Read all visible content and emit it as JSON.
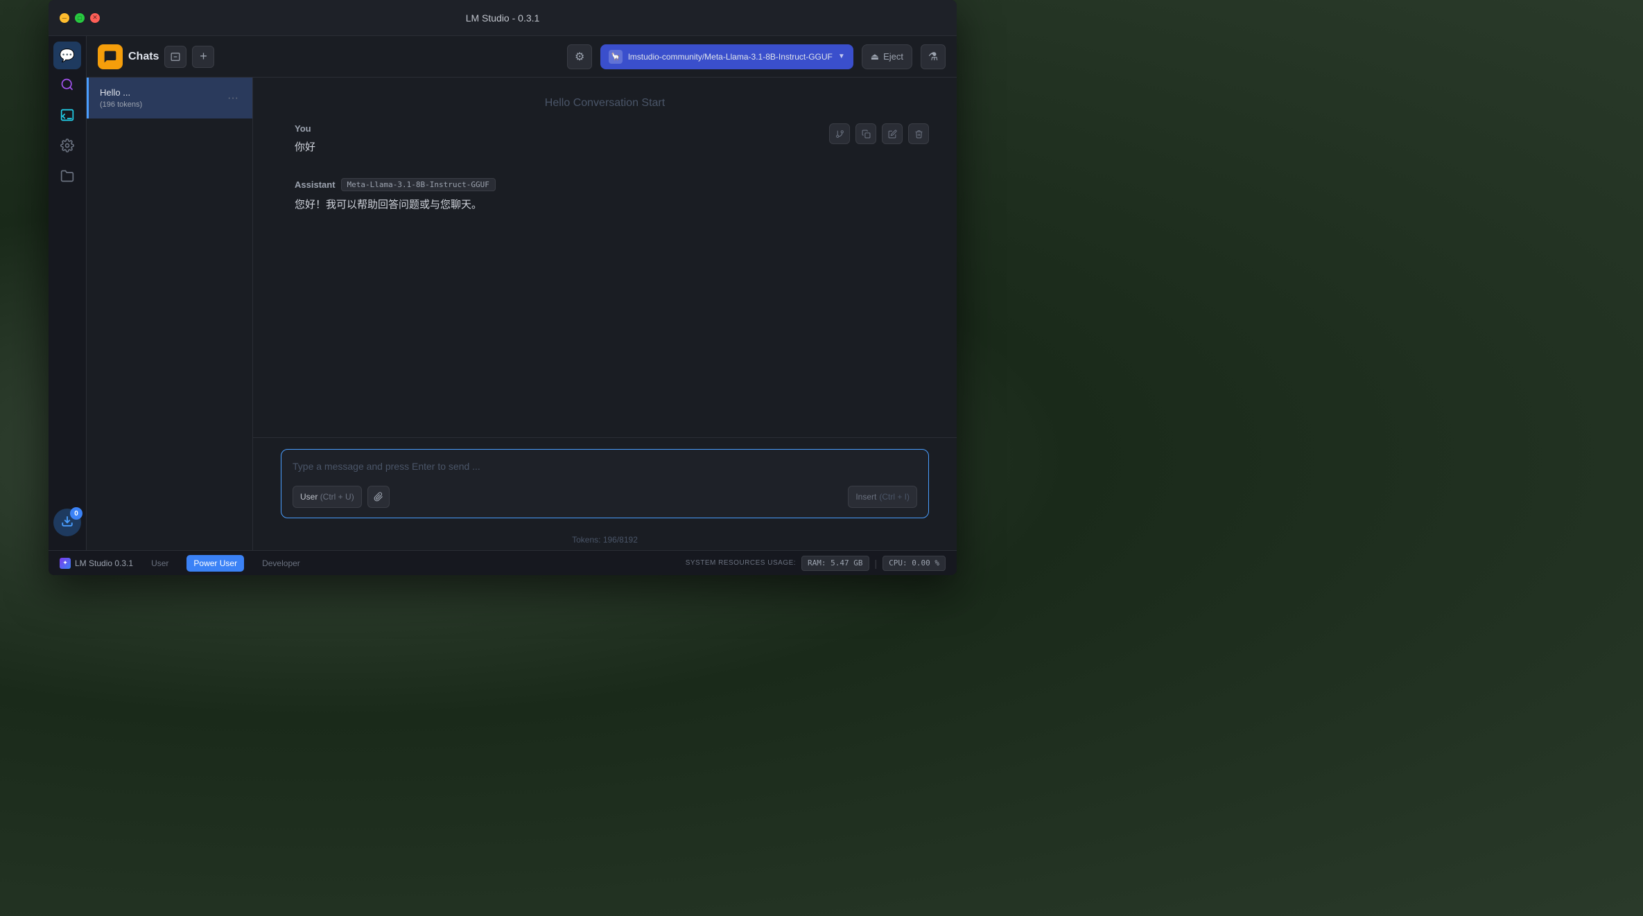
{
  "window": {
    "title": "LM Studio - 0.3.1"
  },
  "titlebar": {
    "title": "LM Studio - 0.3.1"
  },
  "sidebar_icons": {
    "chat_label": "💬",
    "telescope_label": "🔭",
    "terminal_label": ">_",
    "settings_label": "⚙",
    "folder_label": "📁",
    "download_label": "↓",
    "download_badge": "0"
  },
  "header": {
    "chat_icon": "💬",
    "title": "Chats",
    "model_name": "lmstudio-community/Meta-Llama-3.1-8B-Instruct-GGUF",
    "eject_label": "Eject",
    "settings_icon": "⚙",
    "flask_icon": "🧪",
    "new_chat_icon": "📋"
  },
  "chat_list": {
    "items": [
      {
        "name": "Hello ...",
        "tokens": "(196 tokens)",
        "active": true
      }
    ]
  },
  "conversation": {
    "title": "Hello Conversation Start",
    "messages": [
      {
        "sender": "You",
        "content": "你好"
      },
      {
        "sender": "Assistant",
        "model_badge": "Meta-Llama-3.1-8B-Instruct-GGUF",
        "content": "您好！我可以帮助回答问题或与您聊天。"
      }
    ],
    "actions": {
      "branch": "⑂",
      "copy": "⧉",
      "edit": "✏",
      "delete": "🗑"
    }
  },
  "input": {
    "placeholder": "Type a message and press Enter to send ...",
    "user_role": "User",
    "user_shortcut": "(Ctrl + U)",
    "attach_icon": "📎",
    "insert_label": "Insert",
    "insert_shortcut": "(Ctrl + I)"
  },
  "token_status": {
    "label": "Tokens: 196/8192"
  },
  "status_bar": {
    "app_name": "LM Studio 0.3.1",
    "tabs": [
      "User",
      "Power User",
      "Developer"
    ],
    "active_tab": "Power User",
    "system_label": "SYSTEM RESOURCES USAGE:",
    "ram_label": "RAM: 5.47 GB",
    "cpu_label": "CPU: 0.00 %"
  }
}
